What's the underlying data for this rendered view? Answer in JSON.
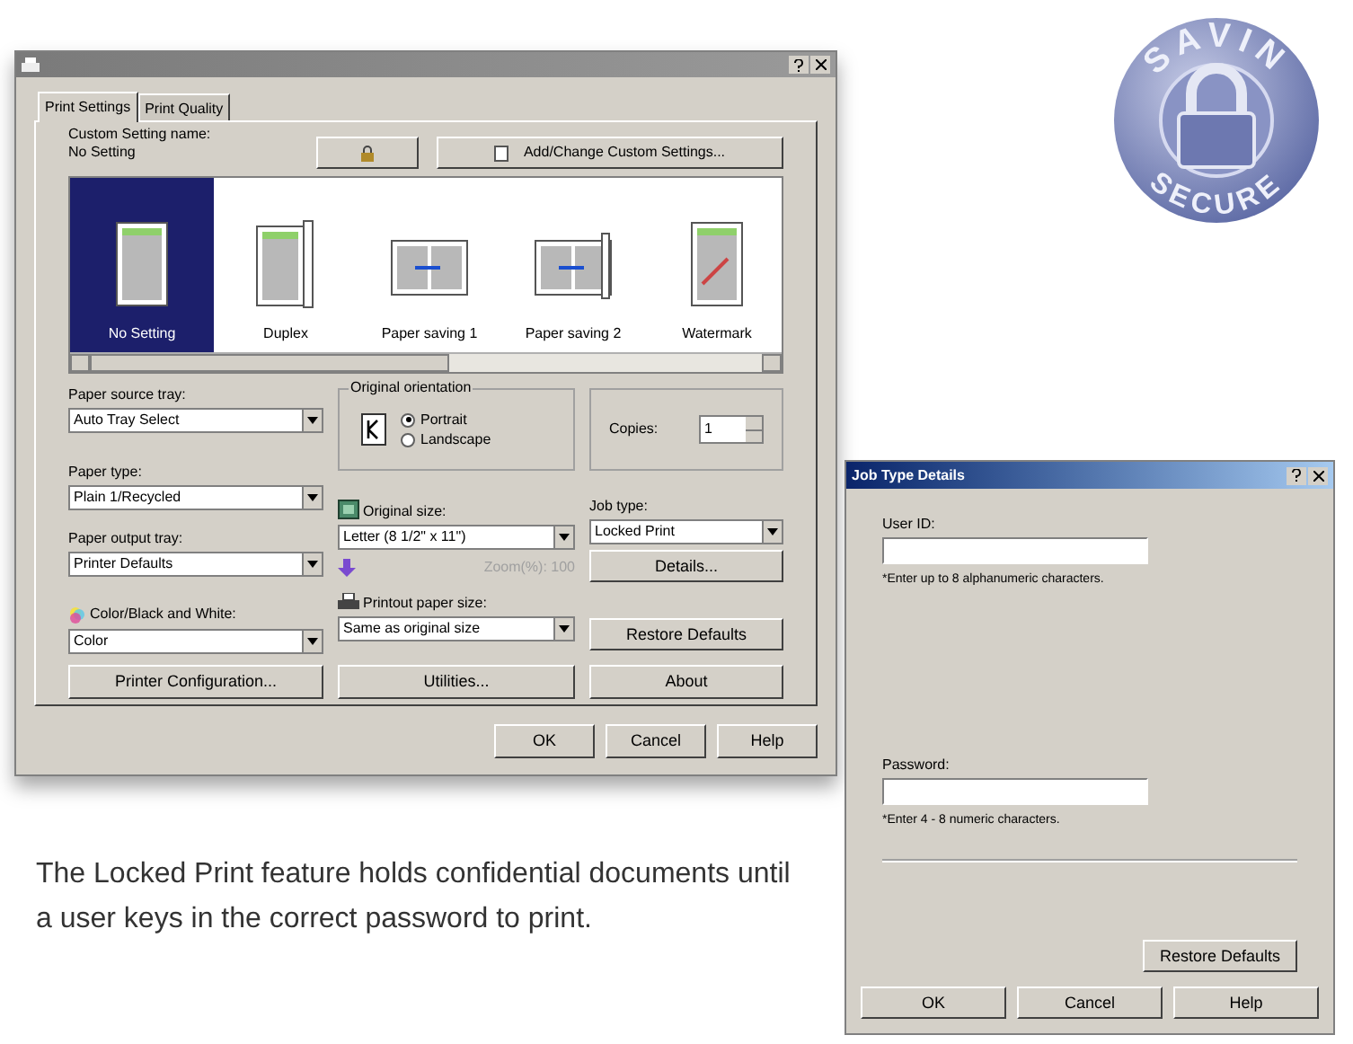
{
  "logo": {
    "top": "SAVIN",
    "bottom": "SECURE"
  },
  "print_dialog": {
    "tabs": [
      {
        "label": "Print Settings",
        "selected": true
      },
      {
        "label": "Print Quality",
        "selected": false
      }
    ],
    "custom_setting": {
      "label": "Custom Setting name:",
      "value": "No Setting",
      "button": "Add/Change Custom Settings..."
    },
    "presets": [
      {
        "label": "No Setting",
        "selected": true
      },
      {
        "label": "Duplex",
        "selected": false
      },
      {
        "label": "Paper saving 1",
        "selected": false
      },
      {
        "label": "Paper saving 2",
        "selected": false
      },
      {
        "label": "Watermark",
        "selected": false
      }
    ],
    "paper_source_tray": {
      "label": "Paper source tray:",
      "value": "Auto Tray Select"
    },
    "paper_type": {
      "label": "Paper type:",
      "value": "Plain 1/Recycled"
    },
    "paper_output_tray": {
      "label": "Paper output tray:",
      "value": "Printer Defaults"
    },
    "color_mode": {
      "label": "Color/Black and White:",
      "value": "Color"
    },
    "orientation": {
      "label": "Original orientation",
      "options": [
        {
          "label": "Portrait",
          "selected": true
        },
        {
          "label": "Landscape",
          "selected": false
        }
      ]
    },
    "original_size": {
      "label": "Original size:",
      "value": "Letter (8 1/2\" x 11\")"
    },
    "zoom": {
      "text": "Zoom(%): 100",
      "disabled": true
    },
    "printout_paper_size": {
      "label": "Printout paper size:",
      "value": "Same as original size"
    },
    "copies": {
      "label": "Copies:",
      "value": "1"
    },
    "job_type": {
      "label": "Job type:",
      "value": "Locked Print"
    },
    "side_buttons": [
      "Details...",
      "Restore Defaults"
    ],
    "bottom_buttons": [
      "Printer Configuration...",
      "Utilities...",
      "About"
    ],
    "dialog_buttons": [
      "OK",
      "Cancel",
      "Help"
    ]
  },
  "job_type_dialog": {
    "title": "Job Type Details",
    "user_id": {
      "label": "User ID:",
      "hint": "*Enter up to 8 alphanumeric characters."
    },
    "password": {
      "label": "Password:",
      "hint": "*Enter 4 - 8 numeric characters."
    },
    "restore_button": "Restore Defaults",
    "dialog_buttons": [
      "OK",
      "Cancel",
      "Help"
    ]
  },
  "caption": "The Locked Print feature holds confidential documents until a user keys in the correct password to print."
}
